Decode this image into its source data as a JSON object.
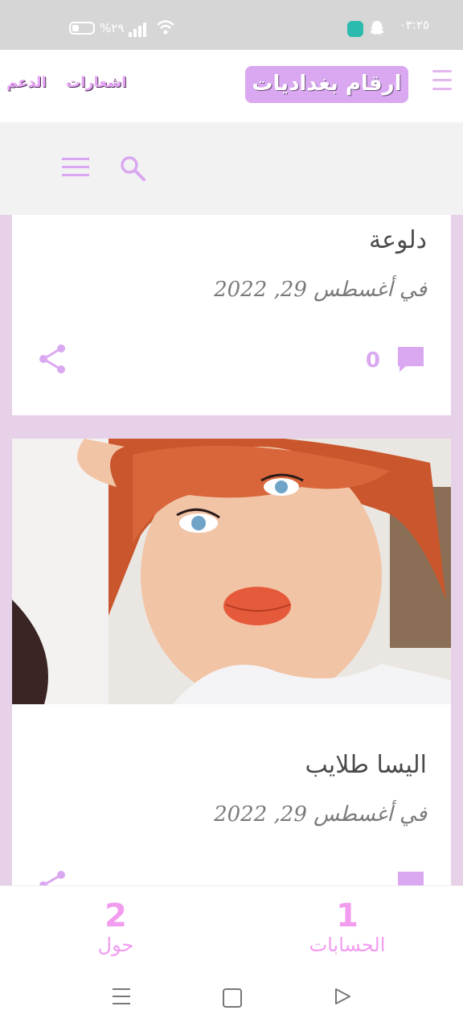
{
  "status_bar": {
    "time": "٠٣:٢٥",
    "battery": "%٢٩"
  },
  "header": {
    "logo_text": "ارقام بغداديات",
    "nav_links": [
      "الدعم",
      "اشعارات"
    ]
  },
  "posts": [
    {
      "title": "دلوعة",
      "date": "في أغسطس 29, 2022",
      "comments": "0"
    },
    {
      "title": "اليسا طلايب",
      "date": "في أغسطس 29, 2022"
    }
  ],
  "bottom_tabs": [
    {
      "number": "1",
      "label": "الحسابات"
    },
    {
      "number": "2",
      "label": "حول"
    }
  ],
  "colors": {
    "accent": "#d9a8f0",
    "tab_text": "#f29cf0",
    "page_bg": "#e6d1e8"
  }
}
